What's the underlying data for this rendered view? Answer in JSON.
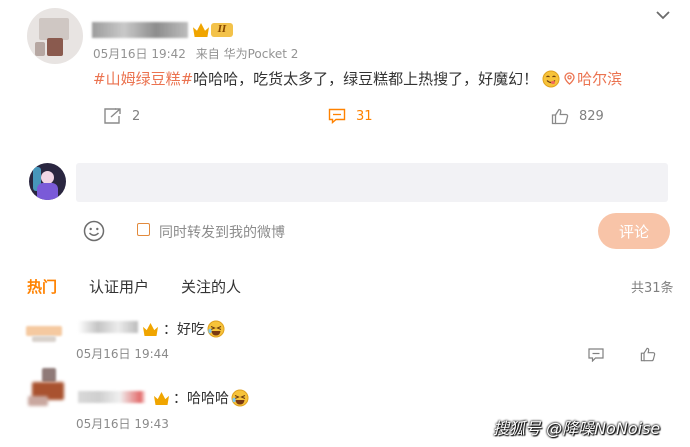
{
  "post": {
    "meta": {
      "date": "05月16日 19:42",
      "source": "来自 华为Pocket 2"
    },
    "vip_level": "II",
    "text": {
      "hashtag": "#山姆绿豆糕#",
      "body": "哈哈哈，吃货太多了，绿豆糕都上热搜了，好魔幻！",
      "location": "哈尔滨"
    },
    "actions": {
      "repost_count": "2",
      "comment_count": "31",
      "like_count": "829"
    }
  },
  "composer": {
    "input_value": "",
    "checkbox_label": "同时转发到我的微博",
    "submit_label": "评论"
  },
  "tabs": {
    "hot": "热门",
    "verified": "认证用户",
    "following": "关注的人",
    "total": "共31条"
  },
  "comments": [
    {
      "text": "：好吃",
      "time": "05月16日 19:44"
    },
    {
      "text": "：哈哈哈",
      "time": "05月16日 19:43"
    }
  ],
  "watermark": "搜狐号 @降噪NoNoise",
  "colors": {
    "accent": "#ff8200",
    "link": "#eb7350",
    "submit_disabled": "#f8c4a8",
    "input_bg": "#f2f2f5"
  },
  "icons": {
    "menu": "chevron-down-icon",
    "repost": "share-icon",
    "comment": "comment-icon",
    "like": "thumbs-up-icon",
    "emoji": "smiley-icon",
    "location": "location-pin-icon"
  }
}
